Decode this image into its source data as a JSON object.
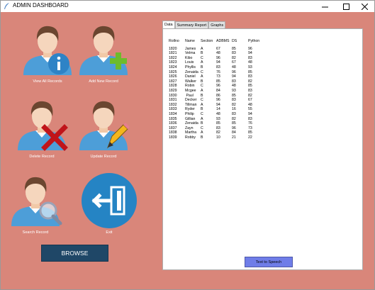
{
  "window": {
    "title": "ADMIN DASHBOARD"
  },
  "colors": {
    "background": "#d9867a",
    "browse_button": "#1f4767",
    "tts_button": "#6f7de8",
    "exit_circle": "#2584c4"
  },
  "actions": {
    "view_all": {
      "label": "View All Records",
      "icon": "user-info-icon"
    },
    "add_new": {
      "label": "Add New Record",
      "icon": "user-add-icon"
    },
    "delete": {
      "label": "Delete Record",
      "icon": "user-delete-icon"
    },
    "update": {
      "label": "Update Record",
      "icon": "user-edit-icon"
    },
    "search": {
      "label": "Search Record",
      "icon": "user-search-icon"
    },
    "exit": {
      "label": "Exit",
      "icon": "exit-door-icon"
    }
  },
  "browse_label": "BROWSE",
  "tabs": [
    "Data",
    "Summary Report",
    "Graphs"
  ],
  "table": {
    "headers": [
      "Rollno",
      "Name",
      "Section",
      "ADBMS",
      "DS",
      "Python"
    ],
    "rows": [
      [
        "1820",
        "James",
        "A",
        "67",
        "85",
        "96"
      ],
      [
        "1821",
        "Velma",
        "B",
        "48",
        "83",
        "94"
      ],
      [
        "1822",
        "Kibo",
        "C",
        "96",
        "82",
        "83"
      ],
      [
        "1823",
        "Louis",
        "A",
        "94",
        "67",
        "48"
      ],
      [
        "1824",
        "Phyllis",
        "B",
        "83",
        "48",
        "93"
      ],
      [
        "1825",
        "Zenaida",
        "C",
        "76",
        "96",
        "85"
      ],
      [
        "1826",
        "Daniel",
        "A",
        "73",
        "94",
        "83"
      ],
      [
        "1827",
        "Walker",
        "B",
        "85",
        "83",
        "82"
      ],
      [
        "1828",
        "Robin",
        "C",
        "96",
        "48",
        "85"
      ],
      [
        "1829",
        "Mcgee",
        "A",
        "84",
        "93",
        "83"
      ],
      [
        "1830",
        " Paul",
        "B",
        "86",
        "85",
        "82"
      ],
      [
        "1831",
        "Decker",
        "C",
        "96",
        "83",
        "67"
      ],
      [
        "1832",
        "Tillman",
        "A",
        "94",
        "82",
        "48"
      ],
      [
        "1833",
        "Ryder",
        "B",
        "14",
        "16",
        "55"
      ],
      [
        "1834",
        "Philip",
        "C",
        "48",
        "83",
        "94"
      ],
      [
        "1835",
        "Gillian",
        "A",
        "93",
        "82",
        "83"
      ],
      [
        "1836",
        "Zenaida",
        "B",
        "85",
        "85",
        "76"
      ],
      [
        "1837",
        "Zayn",
        "C",
        "83",
        "96",
        "73"
      ],
      [
        "1838",
        "Martha",
        "A",
        "82",
        "84",
        "85"
      ],
      [
        "1839",
        "Robby",
        "B",
        "10",
        "21",
        "22"
      ]
    ]
  },
  "tts_label": "Text to Speech"
}
